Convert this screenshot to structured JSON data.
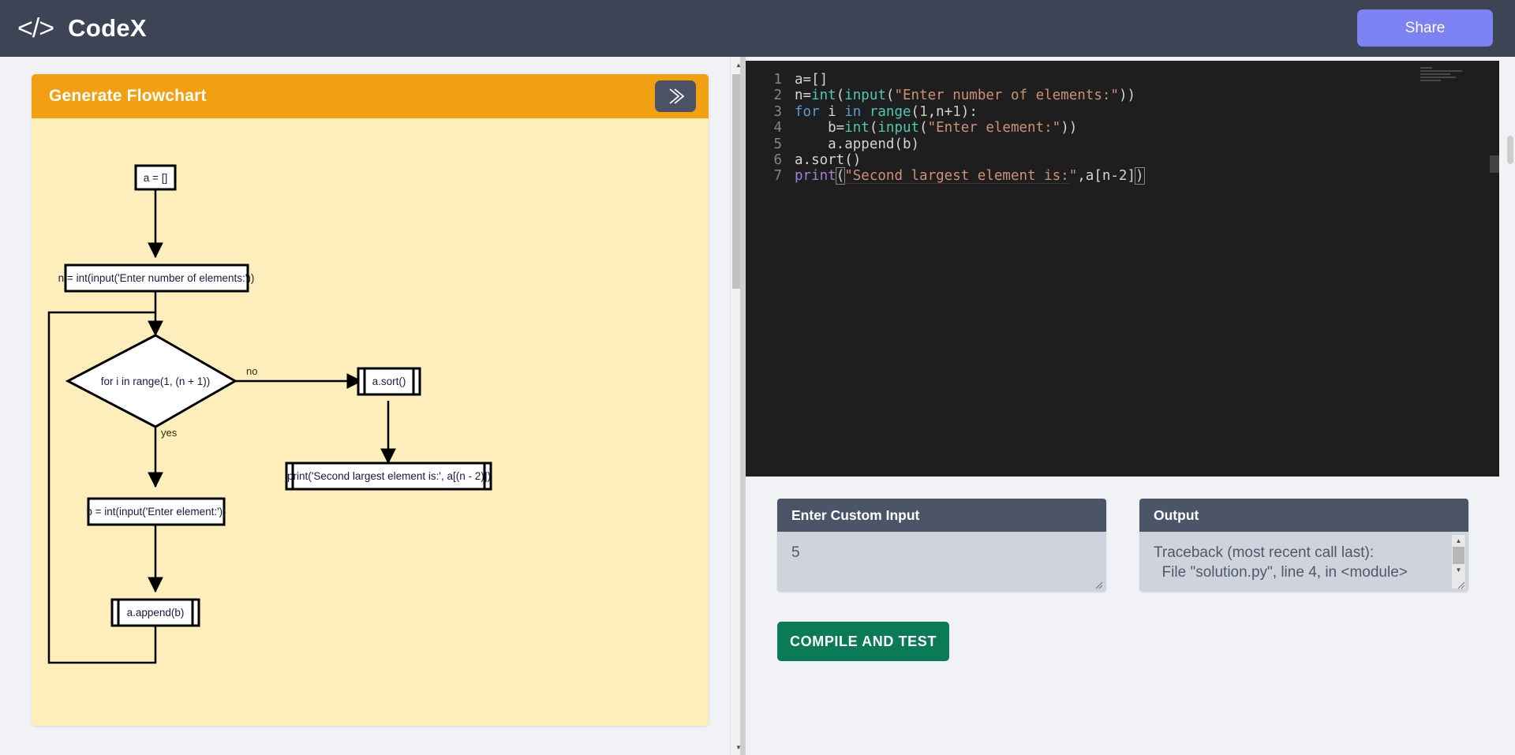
{
  "header": {
    "logo_glyph": "</>",
    "logo_text": "CodeX",
    "share_label": "Share"
  },
  "flowchart_panel": {
    "title": "Generate Flowchart",
    "run_icon": "double-chevron-right-icon",
    "nodes": [
      {
        "id": "start",
        "type": "process",
        "text": "a = []"
      },
      {
        "id": "n",
        "type": "process",
        "text": "n = int(input('Enter number of elements:'))"
      },
      {
        "id": "loop",
        "type": "decision",
        "text": "for i in range(1, (n + 1))"
      },
      {
        "id": "sort",
        "type": "subroutine",
        "text": "a.sort()"
      },
      {
        "id": "print",
        "type": "subroutine",
        "text": "print('Second largest element is:', a[(n - 2)])"
      },
      {
        "id": "b",
        "type": "process",
        "text": "b = int(input('Enter element:'))"
      },
      {
        "id": "append",
        "type": "subroutine",
        "text": "a.append(b)"
      }
    ],
    "edge_labels": {
      "no": "no",
      "yes": "yes"
    }
  },
  "editor": {
    "lines": [
      {
        "num": "1",
        "tokens": [
          {
            "t": "plain",
            "v": "a=[]"
          }
        ]
      },
      {
        "num": "2",
        "tokens": [
          {
            "t": "plain",
            "v": "n="
          },
          {
            "t": "fn",
            "v": "int"
          },
          {
            "t": "plain",
            "v": "("
          },
          {
            "t": "fn",
            "v": "input"
          },
          {
            "t": "plain",
            "v": "("
          },
          {
            "t": "str",
            "v": "\"Enter number of elements:\""
          },
          {
            "t": "plain",
            "v": "))"
          }
        ]
      },
      {
        "num": "3",
        "tokens": [
          {
            "t": "kw",
            "v": "for"
          },
          {
            "t": "plain",
            "v": " i "
          },
          {
            "t": "kw",
            "v": "in"
          },
          {
            "t": "plain",
            "v": " "
          },
          {
            "t": "fn",
            "v": "range"
          },
          {
            "t": "plain",
            "v": "("
          },
          {
            "t": "num",
            "v": "1"
          },
          {
            "t": "plain",
            "v": ",n+"
          },
          {
            "t": "num",
            "v": "1"
          },
          {
            "t": "plain",
            "v": "):"
          }
        ]
      },
      {
        "num": "4",
        "tokens": [
          {
            "t": "plain",
            "v": "    b="
          },
          {
            "t": "fn",
            "v": "int"
          },
          {
            "t": "plain",
            "v": "("
          },
          {
            "t": "fn",
            "v": "input"
          },
          {
            "t": "plain",
            "v": "("
          },
          {
            "t": "str",
            "v": "\"Enter element:\""
          },
          {
            "t": "plain",
            "v": "))"
          }
        ]
      },
      {
        "num": "5",
        "tokens": [
          {
            "t": "plain",
            "v": "    a.append(b)"
          }
        ]
      },
      {
        "num": "6",
        "tokens": [
          {
            "t": "plain",
            "v": "a.sort()"
          }
        ]
      },
      {
        "num": "7",
        "tokens": [
          {
            "t": "print",
            "v": "print"
          },
          {
            "t": "plain",
            "v": "("
          },
          {
            "t": "str",
            "v": "\"Second largest element is:\""
          },
          {
            "t": "plain",
            "v": ",a[n-2])"
          }
        ]
      }
    ],
    "raw_code": "a=[]\nn=int(input(\"Enter number of elements:\"))\nfor i in range(1,n+1):\n    b=int(input(\"Enter element:\"))\n    a.append(b)\na.sort()\nprint(\"Second largest element is:\",a[n-2])"
  },
  "custom_input": {
    "title": "Enter Custom Input",
    "value": "5",
    "placeholder": ""
  },
  "output": {
    "title": "Output",
    "lines": [
      "Traceback (most recent call last):",
      "  File \"solution.py\", line 4, in <module>"
    ]
  },
  "actions": {
    "compile_label": "COMPILE AND TEST"
  },
  "colors": {
    "header_bg": "#3d4455",
    "share_btn": "#7d82f3",
    "flow_header": "#f2a011",
    "flow_canvas": "#fdeebb",
    "panel_head": "#4c5467",
    "panel_body": "#ced3dc",
    "compile_btn": "#0b7a56",
    "editor_bg": "#1e1e1e"
  }
}
